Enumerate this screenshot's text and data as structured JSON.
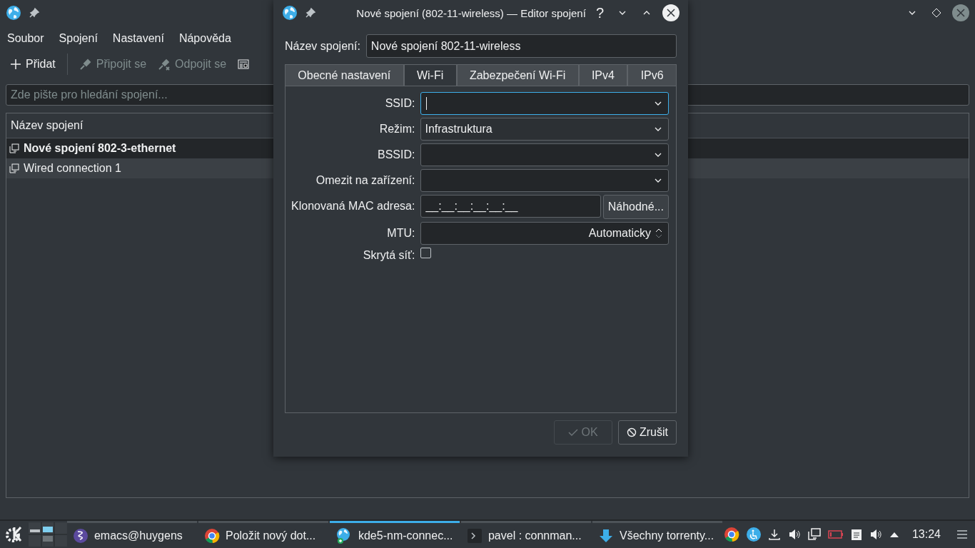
{
  "main_window": {
    "menu": [
      "Soubor",
      "Spojení",
      "Nastavení",
      "Nápověda"
    ],
    "toolbar": [
      {
        "kind": "add",
        "label": "Přidat",
        "disabled": false
      },
      {
        "kind": "connect",
        "label": "Připojit se",
        "disabled": true
      },
      {
        "kind": "disconnect",
        "label": "Odpojit se",
        "disabled": true
      },
      {
        "kind": "details",
        "disabled": false
      }
    ],
    "search": {
      "placeholder": "Zde pište pro hledání spojení..."
    },
    "list": {
      "column": "Název spojení",
      "rows": [
        {
          "name": "Nové spojení 802-3-ethernet",
          "active": true,
          "selected": false
        },
        {
          "name": "Wired connection 1",
          "active": false,
          "selected": true
        }
      ]
    }
  },
  "dialog": {
    "title": "Nové spojení (802-11-wireless) — Editor spojení",
    "help": "?",
    "name_label": "Název spojení:",
    "name_value": "Nové spojení 802-11-wireless",
    "tabs": [
      {
        "label": "Obecné nastavení",
        "selected": false
      },
      {
        "label": "Wi-Fi",
        "selected": true
      },
      {
        "label": "Zabezpečení Wi-Fi",
        "selected": false
      },
      {
        "label": "IPv4",
        "selected": false
      },
      {
        "label": "IPv6",
        "selected": false
      }
    ],
    "fields": [
      {
        "kind": "combo",
        "label": "SSID:",
        "focused": true
      },
      {
        "kind": "combo",
        "label": "Režim:",
        "value": "Infrastruktura",
        "focused": false
      },
      {
        "kind": "combo",
        "label": "BSSID:",
        "focused": false
      },
      {
        "kind": "combo",
        "label": "Omezit na zařízení:",
        "focused": false
      },
      {
        "kind": "mac",
        "label": "Klonovaná MAC adresa:",
        "value": "__:__:__:__:__:__",
        "button": "Náhodné...",
        "focused": false
      },
      {
        "kind": "spin",
        "label": "MTU:",
        "value": "Automaticky",
        "focused": false
      },
      {
        "kind": "checkbox",
        "label": "Skrytá síť:",
        "checked": false
      }
    ],
    "buttons": [
      {
        "kind": "ok",
        "label": "OK",
        "disabled": true
      },
      {
        "kind": "cancel",
        "label": "Zrušit",
        "disabled": false
      }
    ]
  },
  "taskbar": {
    "tasks": [
      {
        "kind": "emacs",
        "label": "emacs@huygens",
        "active": false
      },
      {
        "kind": "browser",
        "label": "Položit nový dot...",
        "active": false
      },
      {
        "kind": "globe",
        "label": "kde5-nm-connec...",
        "active": true
      },
      {
        "kind": "terminal",
        "label": "pavel : connman...",
        "active": false
      },
      {
        "kind": "torrent",
        "label": "Všechny torrenty...",
        "active": false
      }
    ],
    "clock": "13:24"
  }
}
